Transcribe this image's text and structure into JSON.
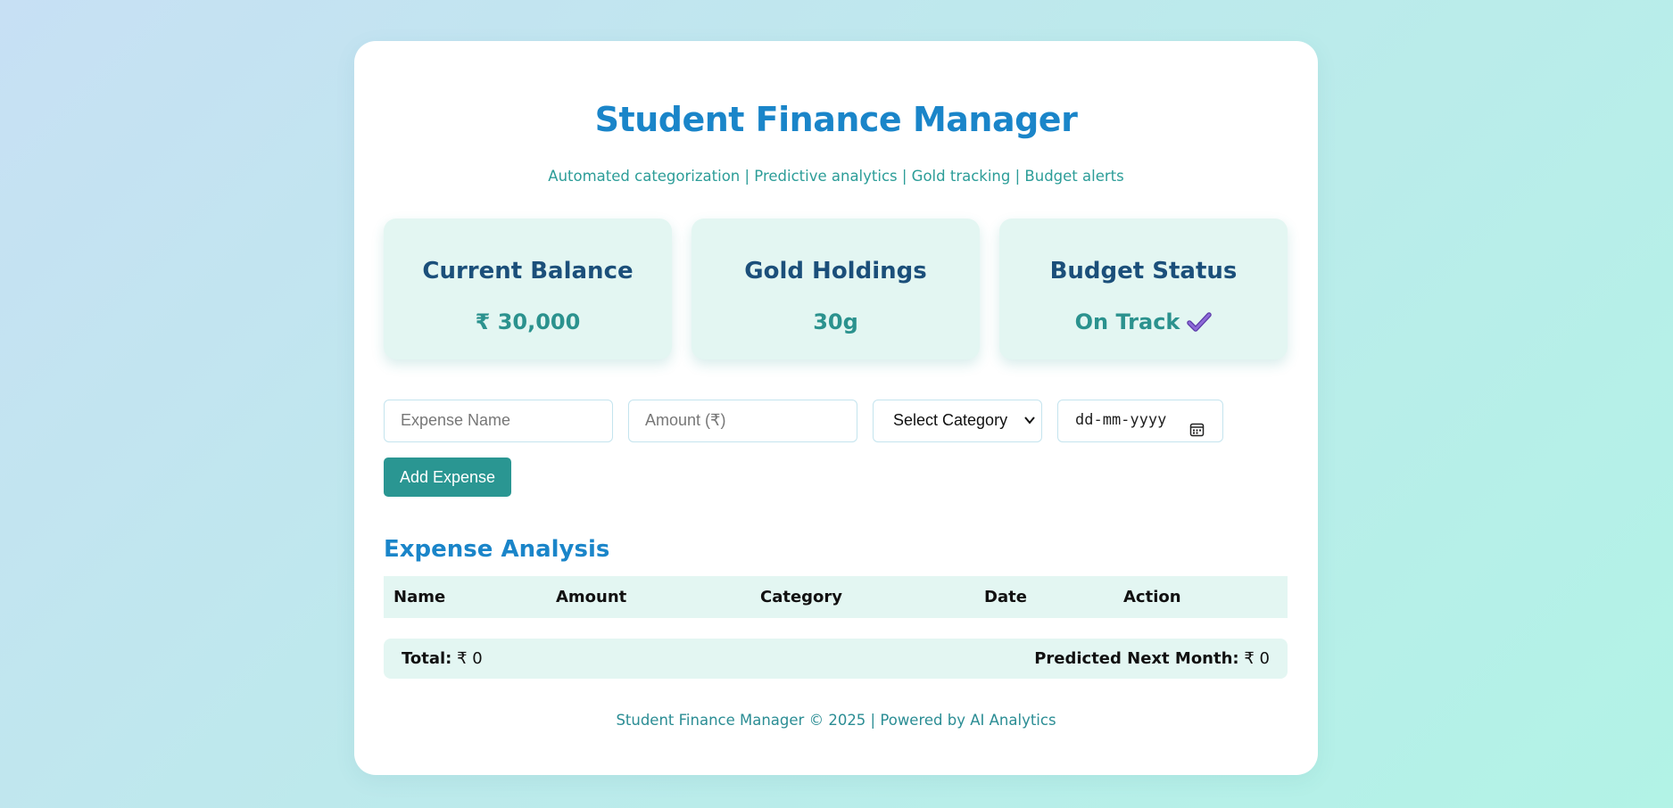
{
  "header": {
    "title": "Student Finance Manager",
    "subtitle": "Automated categorization | Predictive analytics | Gold tracking | Budget alerts"
  },
  "stats": [
    {
      "label": "Current Balance",
      "value": "₹ 30,000"
    },
    {
      "label": "Gold Holdings",
      "value": "30g"
    },
    {
      "label": "Budget Status",
      "value": "On Track",
      "icon": "check-mark-icon"
    }
  ],
  "form": {
    "expense_name_placeholder": "Expense Name",
    "amount_placeholder": "Amount (₹)",
    "category_selected": "Select Category",
    "date_placeholder": "dd-mm-yyyy",
    "add_button_label": "Add Expense"
  },
  "analysis": {
    "title": "Expense Analysis",
    "columns": [
      "Name",
      "Amount",
      "Category",
      "Date",
      "Action"
    ],
    "rows": [],
    "total_label": "Total:",
    "total_value": "₹ 0",
    "predicted_label": "Predicted Next Month:",
    "predicted_value": "₹ 0"
  },
  "footer": {
    "text": "Student Finance Manager © 2025 | Powered by AI Analytics"
  },
  "colors": {
    "accent_blue": "#1a85c9",
    "teal": "#2a9692",
    "card_bg": "#e3f6f2",
    "heading_navy": "#1b4f7a",
    "check_purple": "#7a55c9"
  }
}
